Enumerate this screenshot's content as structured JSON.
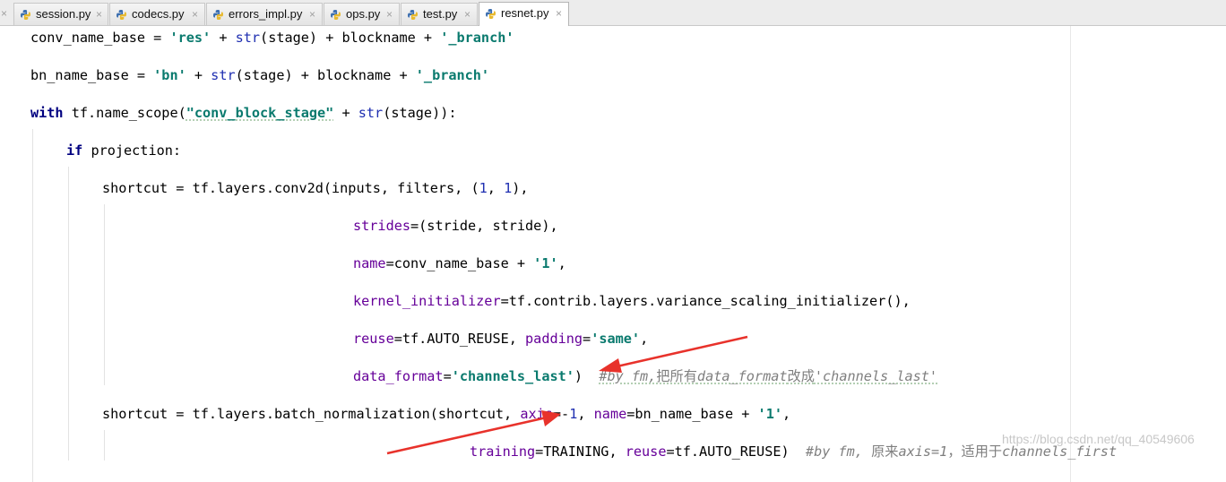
{
  "tabs": [
    {
      "label": "session.py"
    },
    {
      "label": "codecs.py"
    },
    {
      "label": "errors_impl.py"
    },
    {
      "label": "ops.py"
    },
    {
      "label": "test.py"
    },
    {
      "label": "resnet.py"
    }
  ],
  "active_tab": "resnet.py",
  "close_glyph": "×",
  "code": {
    "line1": {
      "a": "conv_name_base = ",
      "s1": "'res'",
      "b": " + ",
      "bi": "str",
      "c": "(stage) + blockname + ",
      "s2": "'_branch'"
    },
    "line2": {
      "a": "bn_name_base = ",
      "s1": "'bn'",
      "b": " + ",
      "bi": "str",
      "c": "(stage) + blockname + ",
      "s2": "'_branch'"
    },
    "line3": {
      "kw": "with",
      "a": " tf.name_scope(",
      "s1": "\"conv_block_stage\"",
      "b": " + ",
      "bi": "str",
      "c": "(stage)):"
    },
    "line4": {
      "kw": "if",
      "a": " projection:"
    },
    "line5": {
      "a": "shortcut = tf.layers.conv2d(inputs, filters, (",
      "n1": "1",
      "b": ", ",
      "n2": "1",
      "c": "),"
    },
    "line6": {
      "p": "strides",
      "a": "=(stride, stride),"
    },
    "line7": {
      "p": "name",
      "a": "=conv_name_base + ",
      "s1": "'1'",
      "b": ","
    },
    "line8": {
      "p": "kernel_initializer",
      "a": "=tf.contrib.layers.variance_scaling_initializer(),"
    },
    "line9": {
      "p1": "reuse",
      "a": "=tf.AUTO_REUSE, ",
      "p2": "padding",
      "b": "=",
      "s1": "'same'",
      "c": ","
    },
    "line10": {
      "p": "data_format",
      "a": "=",
      "s1": "'channels_last'",
      "b": ")  ",
      "c1": "#by fm,",
      "c2": "把所有",
      "c3": "data_format",
      "c4": "改成",
      "c5": "'channels_last'"
    },
    "line11": {
      "a": "shortcut = tf.layers.batch_normalization(shortcut, ",
      "p1": "axis",
      "b": "=-",
      "n1": "1",
      "c": ", ",
      "p2": "name",
      "d": "=bn_name_base + ",
      "s1": "'1'",
      "e": ","
    },
    "line12": {
      "p1": "training",
      "a": "=TRAINING, ",
      "p2": "reuse",
      "b": "=tf.AUTO_REUSE)  ",
      "c1": "#by fm, ",
      "c2": "原来",
      "c3": "axis=1",
      "c4": "，适用于",
      "c5": "channels_first"
    }
  },
  "watermark": "https://blog.csdn.net/qq_40549606",
  "colors": {
    "arrow": "#e8322b",
    "string": "#0a7a6e",
    "keyword": "#000080",
    "param": "#660099",
    "builtin": "#1f2fb1",
    "comment": "#7f7f7f"
  },
  "icons": {
    "tab_file": "python-file-icon"
  }
}
